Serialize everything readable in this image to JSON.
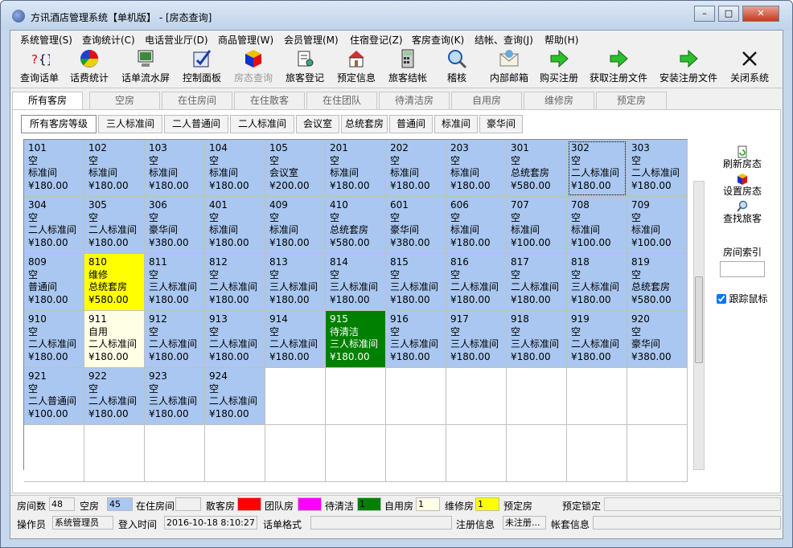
{
  "window": {
    "title": "方讯酒店管理系统【单机版】 - [房态查询]"
  },
  "menu": [
    "系统管理(S)",
    "查询统计(C)",
    "电话营业厅(D)",
    "商品管理(W)",
    "会员管理(M)",
    "住宿登记(Z)",
    "客房查询(K)",
    "结帐、查询(J)",
    "帮助(H)"
  ],
  "toolbar": [
    {
      "label": "查询话单",
      "icon": "query-calls-icon"
    },
    {
      "label": "话费统计",
      "icon": "pie-chart-icon"
    },
    {
      "label": "话单流水屏",
      "icon": "monitor-icon"
    },
    {
      "label": "控制面板",
      "icon": "control-panel-icon"
    },
    {
      "label": "房态查询",
      "icon": "cube-icon",
      "disabled": true
    },
    {
      "label": "旅客登记",
      "icon": "register-icon"
    },
    {
      "label": "预定信息",
      "icon": "booking-icon"
    },
    {
      "label": "旅客结帐",
      "icon": "calculator-icon"
    },
    {
      "label": "稽核",
      "icon": "magnifier-icon"
    },
    {
      "label": "内部邮箱",
      "icon": "mail-icon"
    },
    {
      "label": "购买注册",
      "icon": "arrow-right-icon"
    },
    {
      "label": "获取注册文件",
      "icon": "arrow-right-icon"
    },
    {
      "label": "安装注册文件",
      "icon": "arrow-right-icon"
    },
    {
      "label": "关闭系统",
      "icon": "close-icon"
    }
  ],
  "status_tabs": [
    "所有客房",
    "空房",
    "在住房间",
    "在住散客",
    "在住团队",
    "待清洁房",
    "自用房",
    "维修房",
    "预定房"
  ],
  "room_type_tabs": [
    "所有客房等级",
    "三人标准间",
    "二人普通间",
    "二人标准间",
    "会议室",
    "总统套房",
    "普通间",
    "标准间",
    "豪华间"
  ],
  "rooms": [
    {
      "no": "101",
      "status": "空",
      "type": "标准间",
      "price": "¥180.00",
      "state": "vacant"
    },
    {
      "no": "102",
      "status": "空",
      "type": "标准间",
      "price": "¥180.00",
      "state": "vacant"
    },
    {
      "no": "103",
      "status": "空",
      "type": "标准间",
      "price": "¥180.00",
      "state": "vacant"
    },
    {
      "no": "104",
      "status": "空",
      "type": "标准间",
      "price": "¥180.00",
      "state": "vacant"
    },
    {
      "no": "105",
      "status": "空",
      "type": "会议室",
      "price": "¥200.00",
      "state": "vacant"
    },
    {
      "no": "201",
      "status": "空",
      "type": "标准间",
      "price": "¥180.00",
      "state": "vacant"
    },
    {
      "no": "202",
      "status": "空",
      "type": "标准间",
      "price": "¥180.00",
      "state": "vacant"
    },
    {
      "no": "203",
      "status": "空",
      "type": "标准间",
      "price": "¥180.00",
      "state": "vacant"
    },
    {
      "no": "301",
      "status": "空",
      "type": "总统套房",
      "price": "¥580.00",
      "state": "vacant"
    },
    {
      "no": "302",
      "status": "空",
      "type": "二人标准间",
      "price": "¥180.00",
      "state": "vacant",
      "focused": true
    },
    {
      "no": "303",
      "status": "空",
      "type": "二人标准间",
      "price": "¥180.00",
      "state": "vacant"
    },
    {
      "no": "304",
      "status": "空",
      "type": "二人标准间",
      "price": "¥180.00",
      "state": "vacant"
    },
    {
      "no": "305",
      "status": "空",
      "type": "二人标准间",
      "price": "¥180.00",
      "state": "vacant"
    },
    {
      "no": "306",
      "status": "空",
      "type": "豪华间",
      "price": "¥380.00",
      "state": "vacant"
    },
    {
      "no": "401",
      "status": "空",
      "type": "标准间",
      "price": "¥180.00",
      "state": "vacant"
    },
    {
      "no": "409",
      "status": "空",
      "type": "标准间",
      "price": "¥180.00",
      "state": "vacant"
    },
    {
      "no": "410",
      "status": "空",
      "type": "总统套房",
      "price": "¥580.00",
      "state": "vacant"
    },
    {
      "no": "601",
      "status": "空",
      "type": "豪华间",
      "price": "¥380.00",
      "state": "vacant"
    },
    {
      "no": "606",
      "status": "空",
      "type": "标准间",
      "price": "¥180.00",
      "state": "vacant"
    },
    {
      "no": "707",
      "status": "空",
      "type": "标准间",
      "price": "¥100.00",
      "state": "vacant"
    },
    {
      "no": "708",
      "status": "空",
      "type": "标准间",
      "price": "¥100.00",
      "state": "vacant"
    },
    {
      "no": "709",
      "status": "空",
      "type": "标准间",
      "price": "¥100.00",
      "state": "vacant"
    },
    {
      "no": "809",
      "status": "空",
      "type": "普通间",
      "price": "¥180.00",
      "state": "vacant"
    },
    {
      "no": "810",
      "status": "维修",
      "type": "总统套房",
      "price": "¥580.00",
      "state": "repair"
    },
    {
      "no": "811",
      "status": "空",
      "type": "三人标准间",
      "price": "¥180.00",
      "state": "vacant"
    },
    {
      "no": "812",
      "status": "空",
      "type": "二人标准间",
      "price": "¥180.00",
      "state": "vacant"
    },
    {
      "no": "813",
      "status": "空",
      "type": "三人标准间",
      "price": "¥180.00",
      "state": "vacant"
    },
    {
      "no": "814",
      "status": "空",
      "type": "三人标准间",
      "price": "¥180.00",
      "state": "vacant"
    },
    {
      "no": "815",
      "status": "空",
      "type": "三人标准间",
      "price": "¥180.00",
      "state": "vacant"
    },
    {
      "no": "816",
      "status": "空",
      "type": "二人标准间",
      "price": "¥180.00",
      "state": "vacant"
    },
    {
      "no": "817",
      "status": "空",
      "type": "二人标准间",
      "price": "¥180.00",
      "state": "vacant"
    },
    {
      "no": "818",
      "status": "空",
      "type": "三人标准间",
      "price": "¥180.00",
      "state": "vacant"
    },
    {
      "no": "819",
      "status": "空",
      "type": "总统套房",
      "price": "¥580.00",
      "state": "vacant"
    },
    {
      "no": "910",
      "status": "空",
      "type": "二人标准间",
      "price": "¥180.00",
      "state": "vacant"
    },
    {
      "no": "911",
      "status": "自用",
      "type": "二人标准间",
      "price": "¥180.00",
      "state": "self"
    },
    {
      "no": "912",
      "status": "空",
      "type": "二人标准间",
      "price": "¥180.00",
      "state": "vacant"
    },
    {
      "no": "913",
      "status": "空",
      "type": "二人标准间",
      "price": "¥180.00",
      "state": "vacant"
    },
    {
      "no": "914",
      "status": "空",
      "type": "二人标准间",
      "price": "¥180.00",
      "state": "vacant"
    },
    {
      "no": "915",
      "status": "待清洁",
      "type": "三人标准间",
      "price": "¥180.00",
      "state": "dirty"
    },
    {
      "no": "916",
      "status": "空",
      "type": "三人标准间",
      "price": "¥180.00",
      "state": "vacant"
    },
    {
      "no": "917",
      "status": "空",
      "type": "三人标准间",
      "price": "¥180.00",
      "state": "vacant"
    },
    {
      "no": "918",
      "status": "空",
      "type": "三人标准间",
      "price": "¥180.00",
      "state": "vacant"
    },
    {
      "no": "919",
      "status": "空",
      "type": "二人标准间",
      "price": "¥180.00",
      "state": "vacant"
    },
    {
      "no": "920",
      "status": "空",
      "type": "豪华间",
      "price": "¥380.00",
      "state": "vacant"
    },
    {
      "no": "921",
      "status": "空",
      "type": "二人普通间",
      "price": "¥100.00",
      "state": "vacant"
    },
    {
      "no": "922",
      "status": "空",
      "type": "二人标准间",
      "price": "¥180.00",
      "state": "vacant"
    },
    {
      "no": "923",
      "status": "空",
      "type": "三人标准间",
      "price": "¥180.00",
      "state": "vacant"
    },
    {
      "no": "924",
      "status": "空",
      "type": "二人标准间",
      "price": "¥180.00",
      "state": "vacant"
    }
  ],
  "side": {
    "refresh": "刷新房态",
    "set_status": "设置房态",
    "find_guest": "查找旅客",
    "room_index_label": "房间索引",
    "room_index_value": "",
    "track_mouse": "跟踪鼠标",
    "track_mouse_checked": true
  },
  "legend": {
    "room_count_label": "房间数",
    "room_count": "48",
    "vacant_label": "空房",
    "vacant_count": "45",
    "occupied_label": "在住房间",
    "occupied_count": "",
    "walkin_label": "散客房",
    "walkin_color": "#ff0000",
    "walkin_count": "",
    "group_label": "团队房",
    "group_color": "#ff00ff",
    "group_count": "",
    "dirty_label": "待清洁",
    "dirty_color": "#008000",
    "dirty_count": "1",
    "self_label": "自用房",
    "self_color": "#ffffe6",
    "self_count": "1",
    "repair_label": "维修房",
    "repair_color": "#ffff00",
    "repair_count": "1",
    "reserved_label": "预定房",
    "reserved_count": "",
    "reserved_lock_label": "预定锁定",
    "vacant_color": "#a9c7f0"
  },
  "footer": {
    "operator_label": "操作员",
    "operator": "系统管理员",
    "login_label": "登入时间",
    "login_time": "2016-10-18 8:10:27",
    "format_label": "话单格式",
    "format_value": "",
    "reg_label": "注册信息",
    "reg_value": "未注册...",
    "account_label": "帐套信息"
  }
}
